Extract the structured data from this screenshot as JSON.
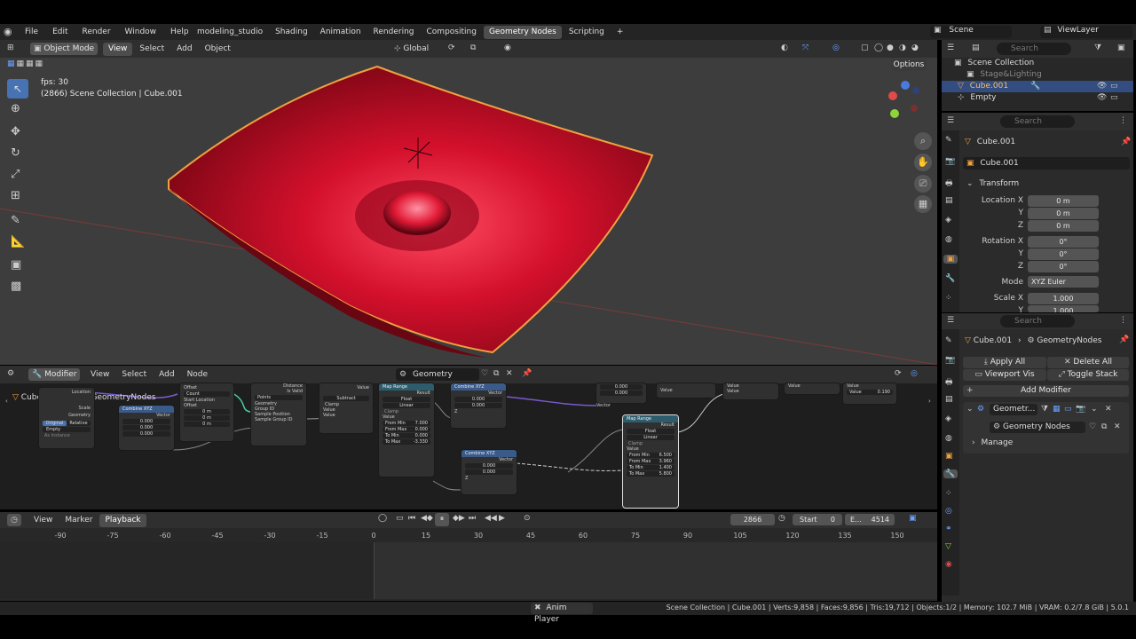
{
  "topbar": {
    "menus": [
      "File",
      "Edit",
      "Render",
      "Window",
      "Help"
    ],
    "workspaces": [
      "modeling_studio",
      "Shading",
      "Animation",
      "Rendering",
      "Compositing",
      "Geometry Nodes",
      "Scripting"
    ],
    "active_workspace": "Geometry Nodes",
    "add_tab": "+",
    "scene": "Scene",
    "view_layer": "ViewLayer"
  },
  "viewport": {
    "mode": "Object Mode",
    "menus": [
      "View",
      "Select",
      "Add",
      "Object"
    ],
    "transform_orientation": "Global",
    "options": "Options",
    "fps": "fps: 30",
    "info": "(2866) Scene Collection | Cube.001",
    "object_color": "#d0102a"
  },
  "outliner": {
    "search_placeholder": "Search",
    "items": [
      {
        "label": "Scene Collection"
      },
      {
        "label": "Stage&Lighting"
      },
      {
        "label": "Cube.001"
      },
      {
        "label": "Empty"
      }
    ]
  },
  "properties": {
    "search_placeholder": "Search",
    "object_name": "Cube.001",
    "object_field": "Cube.001",
    "transform_title": "Transform",
    "location_label": "Location X",
    "y_label": "Y",
    "z_label": "Z",
    "location": [
      "0 m",
      "0 m",
      "0 m"
    ],
    "rotation_label": "Rotation X",
    "rotation": [
      "0°",
      "0°",
      "0°"
    ],
    "mode_label": "Mode",
    "mode": "XYZ Euler",
    "scale_label": "Scale X",
    "scale": [
      "1.000",
      "1.000"
    ]
  },
  "modifiers": {
    "search_placeholder": "Search",
    "object": "Cube.001",
    "context": "GeometryNodes",
    "apply_all": "Apply All",
    "delete_all": "Delete All",
    "viewport_vis": "Viewport Vis",
    "toggle_stack": "Toggle Stack",
    "add_modifier": "Add Modifier",
    "modifier_name": "Geometr...",
    "node_group": "Geometry Nodes",
    "manage": "Manage"
  },
  "node_editor": {
    "editor": "Modifier",
    "menus": [
      "View",
      "Select",
      "Add",
      "Node"
    ],
    "node_tree": "Geometry Nodes",
    "breadcrumb_object": "Cube.001",
    "breadcrumb_tree": "GeometryNodes",
    "nodes": {
      "object_info": {
        "original": "Original",
        "relative": "Relative",
        "empty": "Empty",
        "as_instance": "As Instance",
        "location": "Location",
        "scale": "Scale",
        "geometry": "Geometry"
      },
      "combine1": {
        "title": "Combine XYZ",
        "out": "Vector",
        "x": "0.000",
        "y": "0.000",
        "z": "0.000"
      },
      "count_node": {
        "offset": "Offset",
        "count": "Count",
        "start": "Start Location",
        "offset2": "Offset",
        "x": "0 m",
        "y": "0 m",
        "z": "0 m"
      },
      "proximity": {
        "distance": "Distance",
        "is_valid": "Is Valid",
        "points": "Points",
        "geometry": "Geometry",
        "group_id": "Group ID",
        "sample_pos": "Sample Position",
        "sample_group": "Sample Group ID"
      },
      "math": {
        "value": "Value",
        "op": "Subtract",
        "clamp": "Clamp",
        "v1": "Value",
        "v2": "Value"
      },
      "map1": {
        "title": "Map Range",
        "result": "Result",
        "float": "Float",
        "linear": "Linear",
        "clamp": "Clamp",
        "value": "Value",
        "from_min": "From Min",
        "from_min_v": "7.000",
        "from_max": "From Max",
        "from_max_v": "0.000",
        "to_min": "To Min",
        "to_min_v": "0.000",
        "to_max": "To Max",
        "to_max_v": "-3.330"
      },
      "combine2": {
        "title": "Combine XYZ",
        "out": "Vector",
        "x": "0.000",
        "y": "0.000",
        "z": "Z"
      },
      "combine3": {
        "title": "Combine XYZ",
        "out": "Vector",
        "x": "0.000",
        "y": "0.000",
        "z": "Z"
      },
      "map2": {
        "title": "Map Range",
        "result": "Result",
        "float": "Float",
        "linear": "Linear",
        "clamp": "Clamp",
        "value": "Value",
        "from_min": "From Min",
        "from_min_v": "6.500",
        "from_max": "From Max",
        "from_max_v": "3.960",
        "to_min": "To Min",
        "to_min_v": "1.400",
        "to_max": "To Max",
        "to_max_v": "5.800"
      },
      "top": {
        "v1": "0.000",
        "v2": "0.000",
        "vector": "Vector",
        "value": "Value",
        "value_v": "0.190"
      }
    }
  },
  "timeline": {
    "menus": [
      "View",
      "Marker",
      "Playback"
    ],
    "current_frame": "2866",
    "start_label": "Start",
    "start": "0",
    "end_label": "E...",
    "end": "4514",
    "ticks": [
      "-90",
      "-75",
      "-60",
      "-45",
      "-30",
      "-15",
      "0",
      "15",
      "30",
      "45",
      "60",
      "75",
      "90",
      "105",
      "120",
      "135",
      "150"
    ]
  },
  "statusbar": {
    "anim_player": "Anim Player",
    "stats": "Scene Collection | Cube.001 | Verts:9,858 | Faces:9,856 | Tris:19,712 | Objects:1/2 | Memory: 102.7 MiB | VRAM: 0.2/7.8 GiB | 5.0.1"
  }
}
